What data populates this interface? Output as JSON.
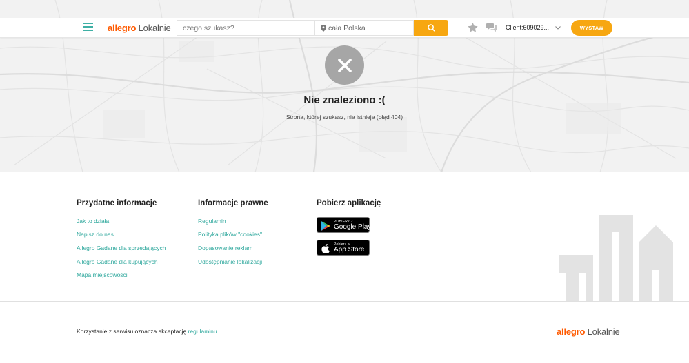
{
  "header": {
    "logo_allegro": "allegro",
    "logo_lokalnie": "Lokalnie",
    "search_placeholder": "czego szukasz?",
    "location": "cała Polska",
    "client_label": "Client:609029...",
    "add_button": "WYSTAW",
    "icons": [
      "menu-icon",
      "search-icon",
      "star-icon",
      "chat-icon",
      "chevron-down-icon",
      "location-pin-icon"
    ]
  },
  "error": {
    "title": "Nie znaleziono :(",
    "subtitle": "Strona, której szukasz, nie istnieje (błąd 404)"
  },
  "footer": {
    "col1": {
      "heading": "Przydatne informacje",
      "links": [
        "Jak to działa",
        "Napisz do nas",
        "Allegro Gadane dla sprzedających",
        "Allegro Gadane dla kupujących",
        "Mapa miejscowości"
      ]
    },
    "col2": {
      "heading": "Informacje prawne",
      "links": [
        "Regulamin",
        "Polityka plików \"cookies\"",
        "Dopasowanie reklam",
        "Udostępnianie lokalizacji"
      ]
    },
    "col3": {
      "heading": "Pobierz aplikację",
      "google_small": "POBIERZ Z",
      "google_big": "Google Play",
      "apple_small": "Pobierz w",
      "apple_big": "App Store"
    },
    "terms_text": "Korzystanie z serwisu oznacza akceptację ",
    "terms_link": "regulaminu",
    "terms_end": ".",
    "bottom_logo_allegro": "allegro",
    "bottom_logo_lokalnie": "Lokalnie"
  },
  "colors": {
    "accent": "#f7a711",
    "link": "#2fa89d",
    "brand": "#ff5a00"
  }
}
